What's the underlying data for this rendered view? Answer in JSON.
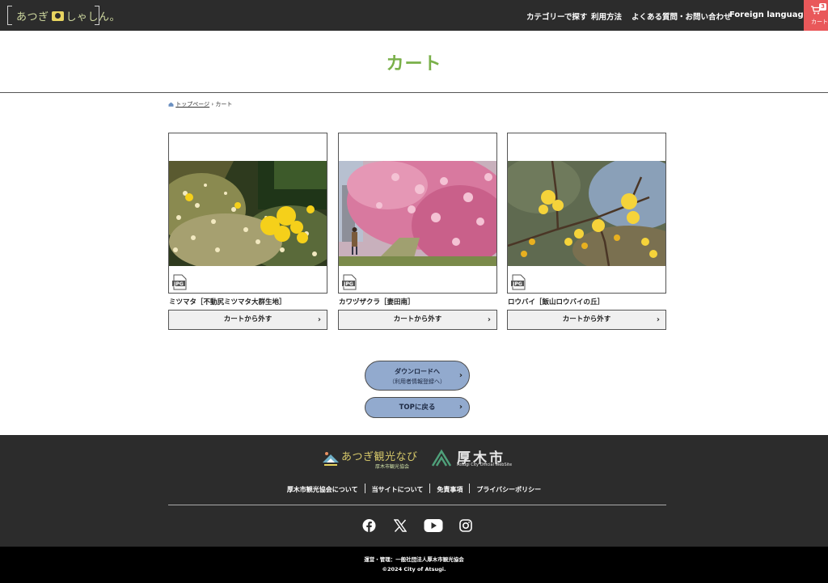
{
  "header": {
    "logo_text_left": "あつぎ",
    "logo_text_right": "しゃしん。",
    "nav": [
      {
        "label": "カテゴリーで探す"
      },
      {
        "label": "利用方法"
      },
      {
        "label": "よくある質問・お問い合わせ"
      },
      {
        "label": "Foreign language"
      }
    ],
    "cart": {
      "label": "カート",
      "count": "3",
      "color": "#e9585a"
    }
  },
  "page": {
    "title": "カート",
    "title_color": "#7ab04a",
    "breadcrumb": {
      "home": "トップページ",
      "separator": "›",
      "current": "カート"
    }
  },
  "cart_items": [
    {
      "name": "ミツマタ［不動尻ミツマタ大群生地］",
      "file_type": "JPG",
      "remove_label": "カートから外す",
      "chevron": "›"
    },
    {
      "name": "カワヅザクラ［妻田南］",
      "file_type": "JPG",
      "remove_label": "カートから外す",
      "chevron": "›"
    },
    {
      "name": "ロウバイ［飯山ロウバイの丘］",
      "file_type": "JPG",
      "remove_label": "カートから外す",
      "chevron": "›"
    }
  ],
  "actions": {
    "download": {
      "label": "ダウンロードへ",
      "sub": "（利用者情報登録へ）",
      "chevron": "›"
    },
    "top": {
      "label": "TOPに戻る",
      "chevron": "›"
    },
    "button_color": "#92aace"
  },
  "footer": {
    "logo1": {
      "main": "あつぎ観光なび",
      "sub": "厚木市観光協会"
    },
    "logo2": {
      "main": "厚木市",
      "sub": "Atsugi City Official WebSite"
    },
    "links": [
      {
        "label": "厚木市観光協会について"
      },
      {
        "label": "当サイトについて"
      },
      {
        "label": "免責事項"
      },
      {
        "label": "プライバシーポリシー"
      }
    ],
    "social": [
      "facebook-icon",
      "x-icon",
      "youtube-icon",
      "instagram-icon"
    ],
    "operator": "運営・管理：一般社団法人厚木市観光協会",
    "copyright": "©2024 City of Atsugi."
  }
}
